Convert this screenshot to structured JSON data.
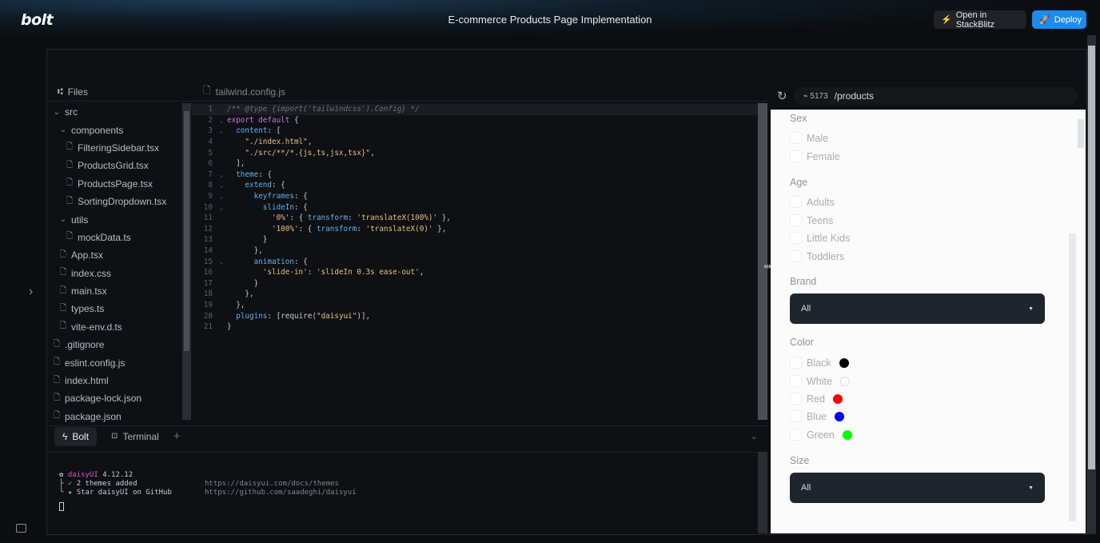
{
  "header": {
    "logo": "bolt",
    "title": "E-commerce Products Page Implementation",
    "open_stackblitz_label": "Open in StackBlitz",
    "deploy_label": "Deploy",
    "accent_color": "#1b8cf0"
  },
  "files": {
    "header_label": "Files",
    "tree": [
      {
        "label": "src",
        "type": "folder",
        "depth": 0,
        "expanded": true
      },
      {
        "label": "components",
        "type": "folder",
        "depth": 1,
        "expanded": true
      },
      {
        "label": "FilteringSidebar.tsx",
        "type": "file",
        "depth": 2
      },
      {
        "label": "ProductsGrid.tsx",
        "type": "file",
        "depth": 2
      },
      {
        "label": "ProductsPage.tsx",
        "type": "file",
        "depth": 2
      },
      {
        "label": "SortingDropdown.tsx",
        "type": "file",
        "depth": 2
      },
      {
        "label": "utils",
        "type": "folder",
        "depth": 1,
        "expanded": true
      },
      {
        "label": "mockData.ts",
        "type": "file",
        "depth": 2
      },
      {
        "label": "App.tsx",
        "type": "file",
        "depth": 1
      },
      {
        "label": "index.css",
        "type": "file",
        "depth": 1
      },
      {
        "label": "main.tsx",
        "type": "file",
        "depth": 1
      },
      {
        "label": "types.ts",
        "type": "file",
        "depth": 1
      },
      {
        "label": "vite-env.d.ts",
        "type": "file",
        "depth": 1
      },
      {
        "label": ".gitignore",
        "type": "file",
        "depth": 0
      },
      {
        "label": "eslint.config.js",
        "type": "file",
        "depth": 0
      },
      {
        "label": "index.html",
        "type": "file",
        "depth": 0
      },
      {
        "label": "package-lock.json",
        "type": "file",
        "depth": 0
      },
      {
        "label": "package.json",
        "type": "file",
        "depth": 0
      }
    ]
  },
  "editor": {
    "filename": "tailwind.config.js",
    "lines": [
      {
        "n": "1",
        "fold": "",
        "html": "<span class=\"c\">/** @type {import('tailwindcss').Config} */</span>"
      },
      {
        "n": "2",
        "fold": "v",
        "html": "<span class=\"k\">export default</span> {"
      },
      {
        "n": "3",
        "fold": "v",
        "html": "  <span class=\"n\">content</span>: ["
      },
      {
        "n": "4",
        "fold": "",
        "html": "    <span class=\"s\">\"./index.html\"</span>,"
      },
      {
        "n": "5",
        "fold": "",
        "html": "    <span class=\"s\">\"./src/**/*.{js,ts,jsx,tsx}\"</span>,"
      },
      {
        "n": "6",
        "fold": "",
        "html": "  ],"
      },
      {
        "n": "7",
        "fold": "v",
        "html": "  <span class=\"n\">theme</span>: {"
      },
      {
        "n": "8",
        "fold": "v",
        "html": "    <span class=\"n\">extend</span>: {"
      },
      {
        "n": "9",
        "fold": "v",
        "html": "      <span class=\"n\">keyframes</span>: {"
      },
      {
        "n": "10",
        "fold": "v",
        "html": "        <span class=\"n\">slideIn</span>: {"
      },
      {
        "n": "11",
        "fold": "",
        "html": "          <span class=\"s\">'0%'</span>: { <span class=\"n\">transform</span>: <span class=\"s\">'translateX(100%)'</span> },"
      },
      {
        "n": "12",
        "fold": "",
        "html": "          <span class=\"s\">'100%'</span>: { <span class=\"n\">transform</span>: <span class=\"s\">'translateX(0)'</span> },"
      },
      {
        "n": "13",
        "fold": "",
        "html": "        }"
      },
      {
        "n": "14",
        "fold": "",
        "html": "      },"
      },
      {
        "n": "15",
        "fold": "v",
        "html": "      <span class=\"n\">animation</span>: {"
      },
      {
        "n": "16",
        "fold": "",
        "html": "        <span class=\"s\">'slide-in'</span>: <span class=\"s\">'slideIn 0.3s ease-out'</span>,"
      },
      {
        "n": "17",
        "fold": "",
        "html": "      }"
      },
      {
        "n": "18",
        "fold": "",
        "html": "    },"
      },
      {
        "n": "19",
        "fold": "",
        "html": "  },"
      },
      {
        "n": "20",
        "fold": "",
        "html": "  <span class=\"n\">plugins</span>: [require(<span class=\"s\">\"daisyui\"</span>)],"
      },
      {
        "n": "21",
        "fold": "",
        "html": "}"
      }
    ]
  },
  "terminal": {
    "tab_bolt": "Bolt",
    "tab_terminal": "Terminal",
    "add_label": "+",
    "daisy_name": "daisyUI",
    "daisy_version": "4.12.12",
    "themes_added": "2 themes added",
    "themes_url": "https://daisyui.com/docs/themes",
    "star_label": "Star daisyUI on GitHub",
    "star_url": "https://github.com/saadeghi/daisyui"
  },
  "preview": {
    "port": "5173",
    "path": "/products",
    "sections": {
      "sex": {
        "title": "Sex",
        "options": [
          "Male",
          "Female"
        ]
      },
      "age": {
        "title": "Age",
        "options": [
          "Adults",
          "Teens",
          "Little Kids",
          "Toddlers"
        ]
      },
      "brand": {
        "title": "Brand",
        "selected": "All"
      },
      "color": {
        "title": "Color",
        "options": [
          {
            "label": "Black",
            "swatch": "#000000"
          },
          {
            "label": "White",
            "swatch": "#ffffff"
          },
          {
            "label": "Red",
            "swatch": "#ff0000"
          },
          {
            "label": "Blue",
            "swatch": "#0000ff"
          },
          {
            "label": "Green",
            "swatch": "#00ff00"
          }
        ]
      },
      "size": {
        "title": "Size",
        "selected": "All"
      }
    }
  }
}
